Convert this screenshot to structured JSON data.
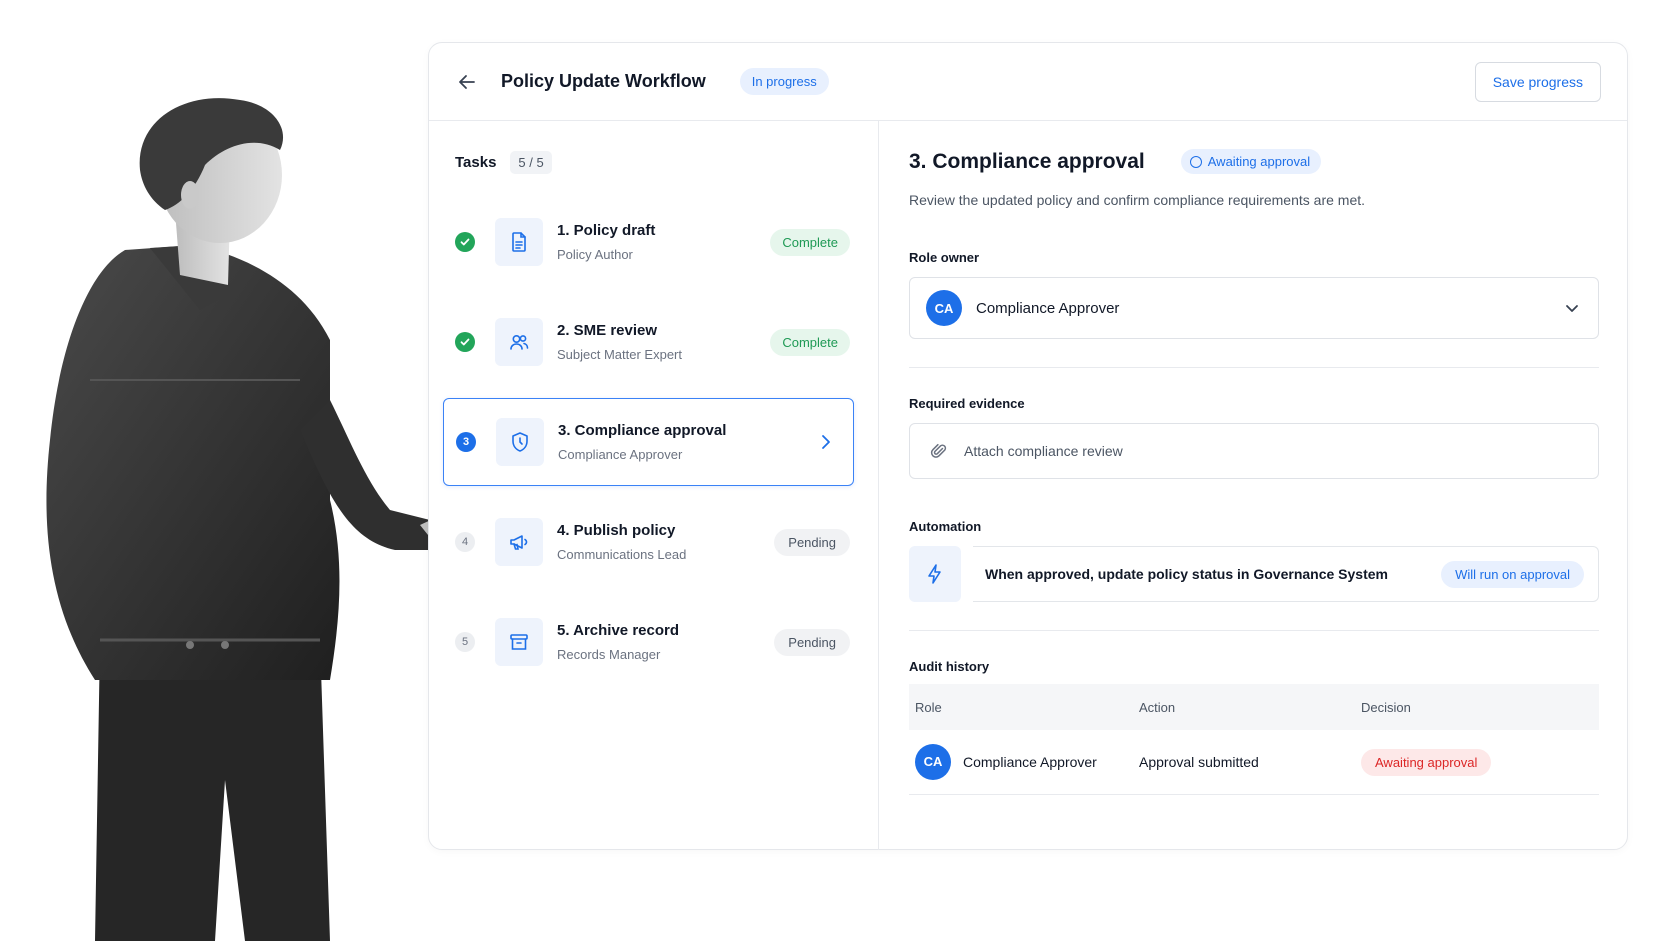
{
  "header": {
    "title": "Policy Update Workflow",
    "status": "In progress",
    "save_label": "Save progress"
  },
  "tasks": {
    "label": "Tasks",
    "count": "5 / 5",
    "items": [
      {
        "number": "1",
        "title": "1. Policy draft",
        "role": "Policy Author",
        "status": "Complete",
        "icon": "document-icon"
      },
      {
        "number": "2",
        "title": "2. SME review",
        "role": "Subject Matter Expert",
        "status": "Complete",
        "icon": "users-icon"
      },
      {
        "number": "3",
        "title": "3. Compliance approval",
        "role": "Compliance Approver",
        "status": "",
        "icon": "shield-icon"
      },
      {
        "number": "4",
        "title": "4. Publish policy",
        "role": "Communications Lead",
        "status": "Pending",
        "icon": "megaphone-icon"
      },
      {
        "number": "5",
        "title": "5. Archive record",
        "role": "Records Manager",
        "status": "Pending",
        "icon": "archive-icon"
      }
    ]
  },
  "detail": {
    "title": "3. Compliance approval",
    "status": "Awaiting approval",
    "description": "Review the updated policy and confirm compliance requirements are met.",
    "role_owner_label": "Role owner",
    "role_owner": {
      "initials": "CA",
      "name": "Compliance Approver"
    },
    "evidence_label": "Required evidence",
    "evidence_placeholder": "Attach compliance review",
    "automation_label": "Automation",
    "automation_text": "When approved, update policy status in Governance System",
    "automation_status": "Will run on approval",
    "audit_label": "Audit history",
    "audit_columns": [
      "Role",
      "Action",
      "Decision"
    ],
    "audit_rows": [
      {
        "initials": "CA",
        "role": "Compliance Approver",
        "action": "Approval submitted",
        "decision": "Awaiting approval"
      }
    ]
  },
  "colors": {
    "accent": "#1d6fe8",
    "complete": "#22a55a",
    "awaiting_red": "#dc2626"
  }
}
